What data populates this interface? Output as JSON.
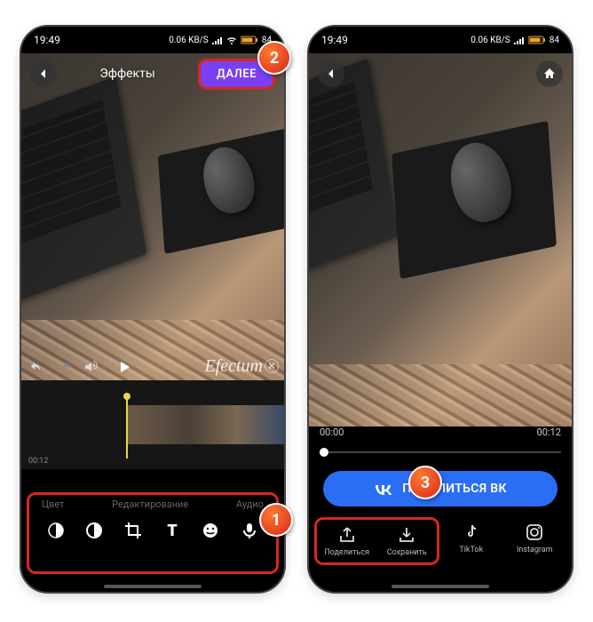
{
  "status": {
    "time": "19:49",
    "net": "0.06 KB/S",
    "battery": "84"
  },
  "left": {
    "title": "Эффекты",
    "next_label": "ДАЛЕЕ",
    "watermark": "Efectum",
    "timestamp": "00:12",
    "tabs": {
      "color": "Цвет",
      "edit": "Редактирование",
      "audio": "Аудио"
    }
  },
  "right": {
    "time_start": "00:00",
    "time_end": "00:12",
    "vk_label": "ПОДЕЛИТЬСЯ ВК",
    "share": {
      "share": "Поделиться",
      "save": "Сохранить",
      "tiktok": "TikTok",
      "instagram": "Instagram"
    }
  },
  "callouts": {
    "c1": "1",
    "c2": "2",
    "c3": "3"
  }
}
